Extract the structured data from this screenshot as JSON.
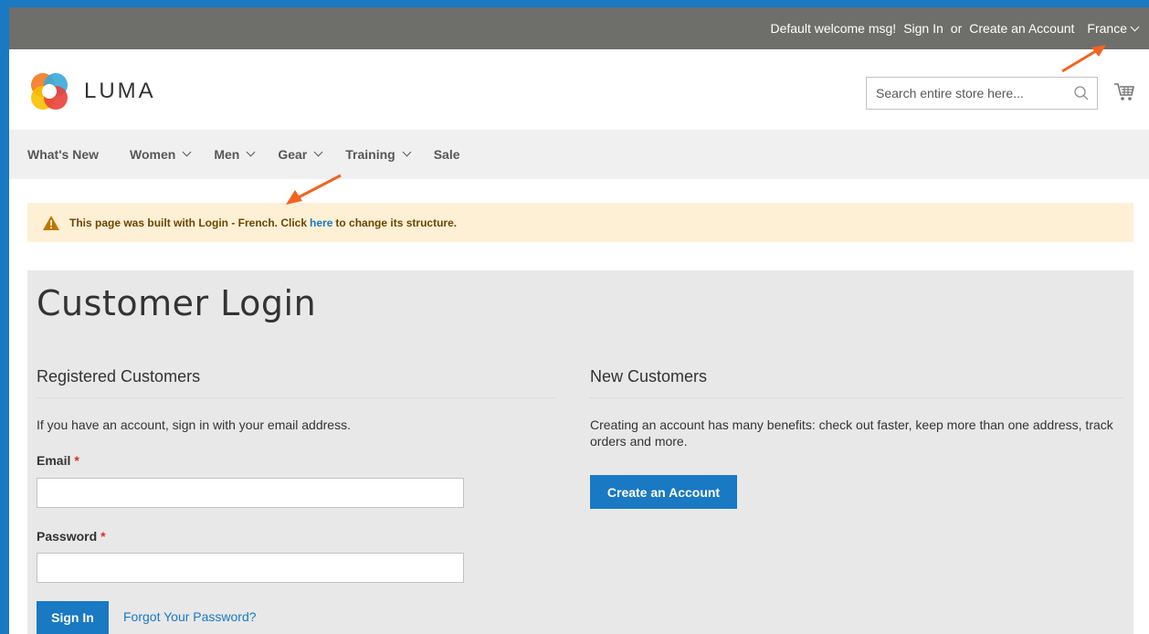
{
  "top_bar": {
    "welcome": "Default welcome msg!",
    "sign_in": "Sign In",
    "or": "or",
    "create_account": "Create an Account",
    "store": "France"
  },
  "header": {
    "logo_text": "LUMA",
    "search_placeholder": "Search entire store here..."
  },
  "nav": {
    "items": [
      {
        "label": "What's New"
      },
      {
        "label": "Women"
      },
      {
        "label": "Men"
      },
      {
        "label": "Gear"
      },
      {
        "label": "Training"
      },
      {
        "label": "Sale"
      }
    ]
  },
  "notice": {
    "prefix": "This page was built with Login - French. Click",
    "link": "here",
    "suffix": "to change its structure."
  },
  "main": {
    "title": "Customer Login",
    "registered": {
      "title": "Registered Customers",
      "intro": "If you have an account, sign in with your email address.",
      "email_label": "Email",
      "password_label": "Password",
      "required_mark": "*",
      "sign_in_button": "Sign In",
      "forgot_link": "Forgot Your Password?"
    },
    "new_customers": {
      "title": "New Customers",
      "intro": "Creating an account has many benefits: check out faster, keep more than one address, track orders and more.",
      "create_button": "Create an Account"
    }
  },
  "colors": {
    "accent": "#1979c3",
    "annotation_arrow": "#f26322",
    "top_bar": "#6e6e6b",
    "notice_bg": "#fdf0d5"
  }
}
